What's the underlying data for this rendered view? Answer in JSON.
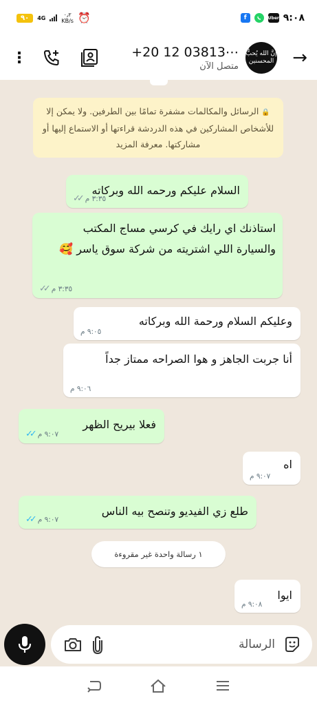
{
  "status_bar": {
    "battery": "٩٠",
    "network": "4G",
    "speed_value": "٠٫٢",
    "speed_unit": "KB/s",
    "time": "٩:٠٨",
    "icons": [
      "facebook-icon",
      "whatsapp-icon",
      "uber-icon",
      "alarm-icon",
      "signal-icon"
    ]
  },
  "header": {
    "contact_name": "+20 12 03813⋯",
    "status": "متصل الآن",
    "avatar_text": "إنَّ الله يُحبُّ المحسنين",
    "icons": [
      "menu-dots-icon",
      "add-call-icon",
      "contact-card-icon",
      "back-arrow-icon"
    ]
  },
  "encryption_notice": "الرسائل والمكالمات مشفرة تمامًا بين الطرفين. ولا يمكن إلا للأشخاص المشاركين في هذه الدردشة قراءتها أو الاستماع إليها أو مشاركتها. معرفة المزيد",
  "messages": [
    {
      "direction": "out",
      "text": "السلام عليكم ورحمه الله وبركاته",
      "time": "٣:٣٥ م",
      "ticks": "read-grey"
    },
    {
      "direction": "out",
      "text": "استاذنك اي رايك في كرسي مساج المكتب والسيارة اللي اشتريته من شركة سوق ياسر 🥰",
      "time": "٣:٣٥ م",
      "ticks": "read-grey"
    },
    {
      "direction": "in",
      "text": "وعليكم السلام ورحمة الله وبركاته",
      "time": "٩:٠٥ م"
    },
    {
      "direction": "in",
      "text": "أنا جربت الجاهز و هوا الصراحه ممتاز جداً",
      "time": "٩:٠٦ م"
    },
    {
      "direction": "out",
      "text": "فعلا بيريح الظهر",
      "time": "٩:٠٧ م",
      "ticks": "read-blue"
    },
    {
      "direction": "in",
      "text": "اه",
      "time": "٩:٠٧ م"
    },
    {
      "direction": "out",
      "text": "طلع زي الفيديو وتنصح بيه الناس",
      "time": "٩:٠٧ م",
      "ticks": "read-blue"
    },
    {
      "direction": "in",
      "text": "ايوا",
      "time": "٩:٠٨ م"
    }
  ],
  "unread_label": "١ رسالة واحدة غير مقروءة",
  "composer": {
    "placeholder": "الرسالة",
    "icons": [
      "mic-icon",
      "camera-icon",
      "attach-icon",
      "sticker-icon"
    ]
  },
  "colors": {
    "outgoing_bubble": "#d9fdd3",
    "incoming_bubble": "#ffffff",
    "chat_background": "#efe7dd",
    "read_tick": "#34b7f1",
    "encryption_bg": "#fdf3c9"
  }
}
